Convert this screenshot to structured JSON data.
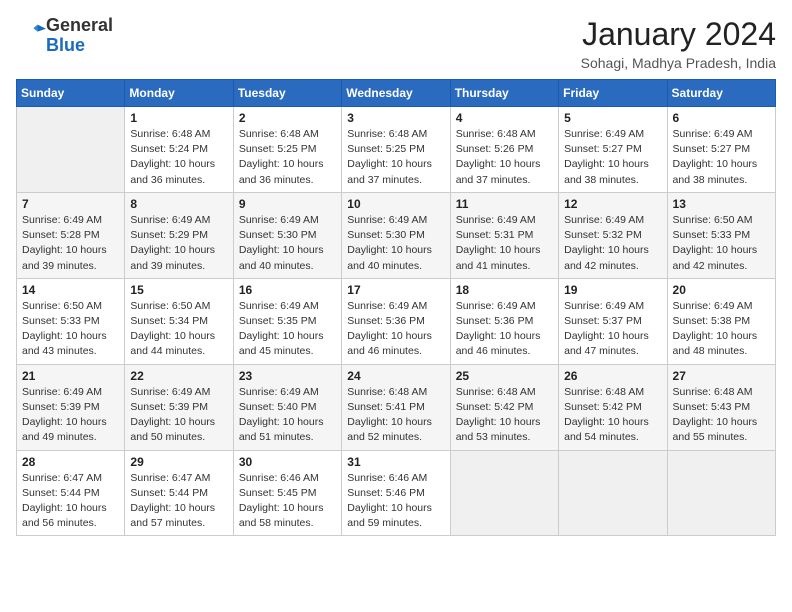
{
  "header": {
    "logo_line1": "General",
    "logo_line2": "Blue",
    "month": "January 2024",
    "location": "Sohagi, Madhya Pradesh, India"
  },
  "weekdays": [
    "Sunday",
    "Monday",
    "Tuesday",
    "Wednesday",
    "Thursday",
    "Friday",
    "Saturday"
  ],
  "weeks": [
    [
      {
        "day": "",
        "empty": true
      },
      {
        "day": "1",
        "sunrise": "6:48 AM",
        "sunset": "5:24 PM",
        "daylight": "10 hours and 36 minutes."
      },
      {
        "day": "2",
        "sunrise": "6:48 AM",
        "sunset": "5:25 PM",
        "daylight": "10 hours and 36 minutes."
      },
      {
        "day": "3",
        "sunrise": "6:48 AM",
        "sunset": "5:25 PM",
        "daylight": "10 hours and 37 minutes."
      },
      {
        "day": "4",
        "sunrise": "6:48 AM",
        "sunset": "5:26 PM",
        "daylight": "10 hours and 37 minutes."
      },
      {
        "day": "5",
        "sunrise": "6:49 AM",
        "sunset": "5:27 PM",
        "daylight": "10 hours and 38 minutes."
      },
      {
        "day": "6",
        "sunrise": "6:49 AM",
        "sunset": "5:27 PM",
        "daylight": "10 hours and 38 minutes."
      }
    ],
    [
      {
        "day": "7",
        "sunrise": "6:49 AM",
        "sunset": "5:28 PM",
        "daylight": "10 hours and 39 minutes."
      },
      {
        "day": "8",
        "sunrise": "6:49 AM",
        "sunset": "5:29 PM",
        "daylight": "10 hours and 39 minutes."
      },
      {
        "day": "9",
        "sunrise": "6:49 AM",
        "sunset": "5:30 PM",
        "daylight": "10 hours and 40 minutes."
      },
      {
        "day": "10",
        "sunrise": "6:49 AM",
        "sunset": "5:30 PM",
        "daylight": "10 hours and 40 minutes."
      },
      {
        "day": "11",
        "sunrise": "6:49 AM",
        "sunset": "5:31 PM",
        "daylight": "10 hours and 41 minutes."
      },
      {
        "day": "12",
        "sunrise": "6:49 AM",
        "sunset": "5:32 PM",
        "daylight": "10 hours and 42 minutes."
      },
      {
        "day": "13",
        "sunrise": "6:50 AM",
        "sunset": "5:33 PM",
        "daylight": "10 hours and 42 minutes."
      }
    ],
    [
      {
        "day": "14",
        "sunrise": "6:50 AM",
        "sunset": "5:33 PM",
        "daylight": "10 hours and 43 minutes."
      },
      {
        "day": "15",
        "sunrise": "6:50 AM",
        "sunset": "5:34 PM",
        "daylight": "10 hours and 44 minutes."
      },
      {
        "day": "16",
        "sunrise": "6:49 AM",
        "sunset": "5:35 PM",
        "daylight": "10 hours and 45 minutes."
      },
      {
        "day": "17",
        "sunrise": "6:49 AM",
        "sunset": "5:36 PM",
        "daylight": "10 hours and 46 minutes."
      },
      {
        "day": "18",
        "sunrise": "6:49 AM",
        "sunset": "5:36 PM",
        "daylight": "10 hours and 46 minutes."
      },
      {
        "day": "19",
        "sunrise": "6:49 AM",
        "sunset": "5:37 PM",
        "daylight": "10 hours and 47 minutes."
      },
      {
        "day": "20",
        "sunrise": "6:49 AM",
        "sunset": "5:38 PM",
        "daylight": "10 hours and 48 minutes."
      }
    ],
    [
      {
        "day": "21",
        "sunrise": "6:49 AM",
        "sunset": "5:39 PM",
        "daylight": "10 hours and 49 minutes."
      },
      {
        "day": "22",
        "sunrise": "6:49 AM",
        "sunset": "5:39 PM",
        "daylight": "10 hours and 50 minutes."
      },
      {
        "day": "23",
        "sunrise": "6:49 AM",
        "sunset": "5:40 PM",
        "daylight": "10 hours and 51 minutes."
      },
      {
        "day": "24",
        "sunrise": "6:48 AM",
        "sunset": "5:41 PM",
        "daylight": "10 hours and 52 minutes."
      },
      {
        "day": "25",
        "sunrise": "6:48 AM",
        "sunset": "5:42 PM",
        "daylight": "10 hours and 53 minutes."
      },
      {
        "day": "26",
        "sunrise": "6:48 AM",
        "sunset": "5:42 PM",
        "daylight": "10 hours and 54 minutes."
      },
      {
        "day": "27",
        "sunrise": "6:48 AM",
        "sunset": "5:43 PM",
        "daylight": "10 hours and 55 minutes."
      }
    ],
    [
      {
        "day": "28",
        "sunrise": "6:47 AM",
        "sunset": "5:44 PM",
        "daylight": "10 hours and 56 minutes."
      },
      {
        "day": "29",
        "sunrise": "6:47 AM",
        "sunset": "5:44 PM",
        "daylight": "10 hours and 57 minutes."
      },
      {
        "day": "30",
        "sunrise": "6:46 AM",
        "sunset": "5:45 PM",
        "daylight": "10 hours and 58 minutes."
      },
      {
        "day": "31",
        "sunrise": "6:46 AM",
        "sunset": "5:46 PM",
        "daylight": "10 hours and 59 minutes."
      },
      {
        "day": "",
        "empty": true
      },
      {
        "day": "",
        "empty": true
      },
      {
        "day": "",
        "empty": true
      }
    ]
  ],
  "labels": {
    "sunrise": "Sunrise:",
    "sunset": "Sunset:",
    "daylight": "Daylight:"
  }
}
